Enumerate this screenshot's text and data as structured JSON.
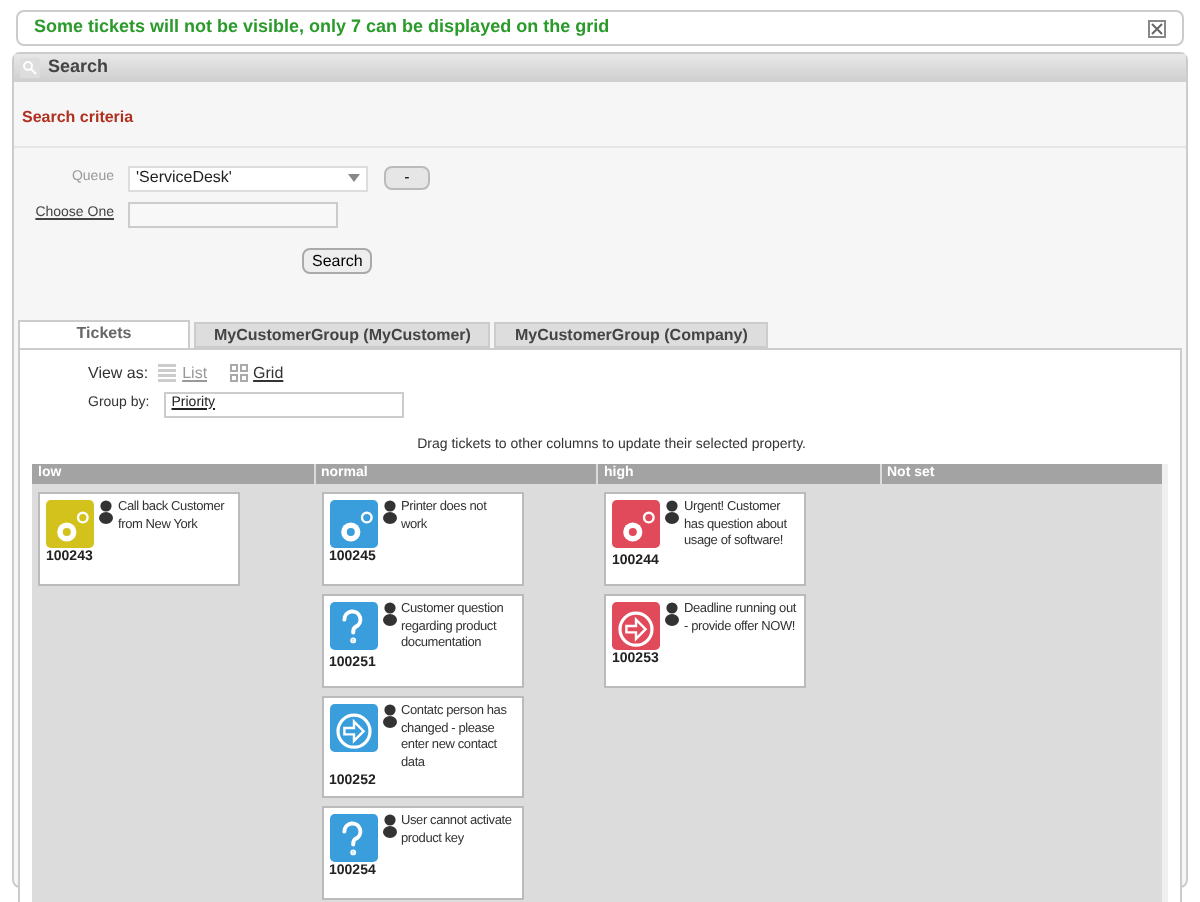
{
  "notice": {
    "text": "Some tickets will not be visible, only 7 can be displayed on the grid"
  },
  "search_panel": {
    "title": "Search",
    "section": "Search criteria",
    "queue_label": "Queue",
    "queue_value": "'ServiceDesk'",
    "minus_button": "-",
    "choose_label": "Choose One",
    "search_button": "Search"
  },
  "tabs": [
    {
      "label": "Tickets",
      "selected": true
    },
    {
      "label": "MyCustomerGroup (MyCustomer)",
      "selected": false
    },
    {
      "label": "MyCustomerGroup (Company)",
      "selected": false
    }
  ],
  "view_as": {
    "label": "View as:",
    "options": [
      {
        "label": "List",
        "selected": false
      },
      {
        "label": "Grid",
        "selected": true
      }
    ]
  },
  "group_by": {
    "label": "Group by:",
    "value": "Priority"
  },
  "hint": "Drag tickets to other columns to update their selected property.",
  "board": {
    "columns": [
      {
        "title": "low",
        "tickets": [
          {
            "kind": "gear",
            "color": "#d4c21c",
            "title": "Call back Customer from New York",
            "id": "100243"
          }
        ]
      },
      {
        "title": "normal",
        "tickets": [
          {
            "kind": "gear",
            "color": "#3a9ddc",
            "title": "Printer does not work",
            "id": "100245"
          },
          {
            "kind": "question",
            "color": "#3a9ddc",
            "title": "Customer question regarding product documentation",
            "id": "100251"
          },
          {
            "kind": "arrow",
            "color": "#3a9ddc",
            "title": "Contatc person has changed - please enter new contact data",
            "id": "100252"
          },
          {
            "kind": "question",
            "color": "#3a9ddc",
            "title": "User cannot activate product key",
            "id": "100254"
          }
        ]
      },
      {
        "title": "high",
        "tickets": [
          {
            "kind": "gear",
            "color": "#e04a5a",
            "title": "Urgent! Customer has question about usage of software!",
            "id": "100244"
          },
          {
            "kind": "arrow",
            "color": "#e04a5a",
            "title": "Deadline running out - provide offer NOW!",
            "id": "100253"
          }
        ]
      },
      {
        "title": "Not set"
      }
    ]
  }
}
